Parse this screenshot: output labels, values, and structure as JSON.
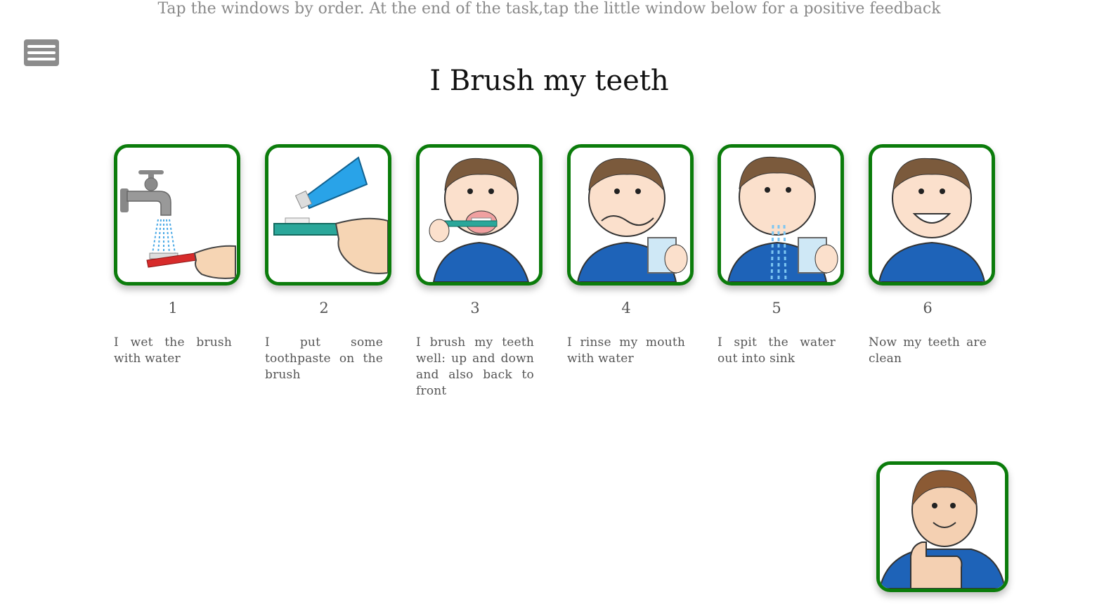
{
  "instruction": "Tap the windows by order. At the end of the task,tap the little window below for a positive feedback",
  "title": "I Brush my teeth",
  "menu": {
    "icon": "hamburger-menu-icon"
  },
  "steps": [
    {
      "number": "1",
      "text": "I wet the brush with water",
      "icon": "tap-water-toothbrush-icon"
    },
    {
      "number": "2",
      "text": "I put some toothpaste on the brush",
      "icon": "toothpaste-on-brush-icon"
    },
    {
      "number": "3",
      "text": "I brush my teeth well: up and down and also back to front",
      "icon": "boy-brushing-teeth-icon"
    },
    {
      "number": "4",
      "text": "I rinse my mouth with water",
      "icon": "boy-rinsing-mouth-icon"
    },
    {
      "number": "5",
      "text": "I spit the water out into sink",
      "icon": "boy-spitting-water-icon"
    },
    {
      "number": "6",
      "text": "Now my teeth are clean",
      "icon": "boy-smiling-clean-teeth-icon"
    }
  ],
  "feedback": {
    "icon": "boy-thumbs-up-icon"
  },
  "colors": {
    "card_border": "#0b7c0b",
    "menu_bg": "#8c8c8c",
    "shirt": "#1e63b8"
  }
}
